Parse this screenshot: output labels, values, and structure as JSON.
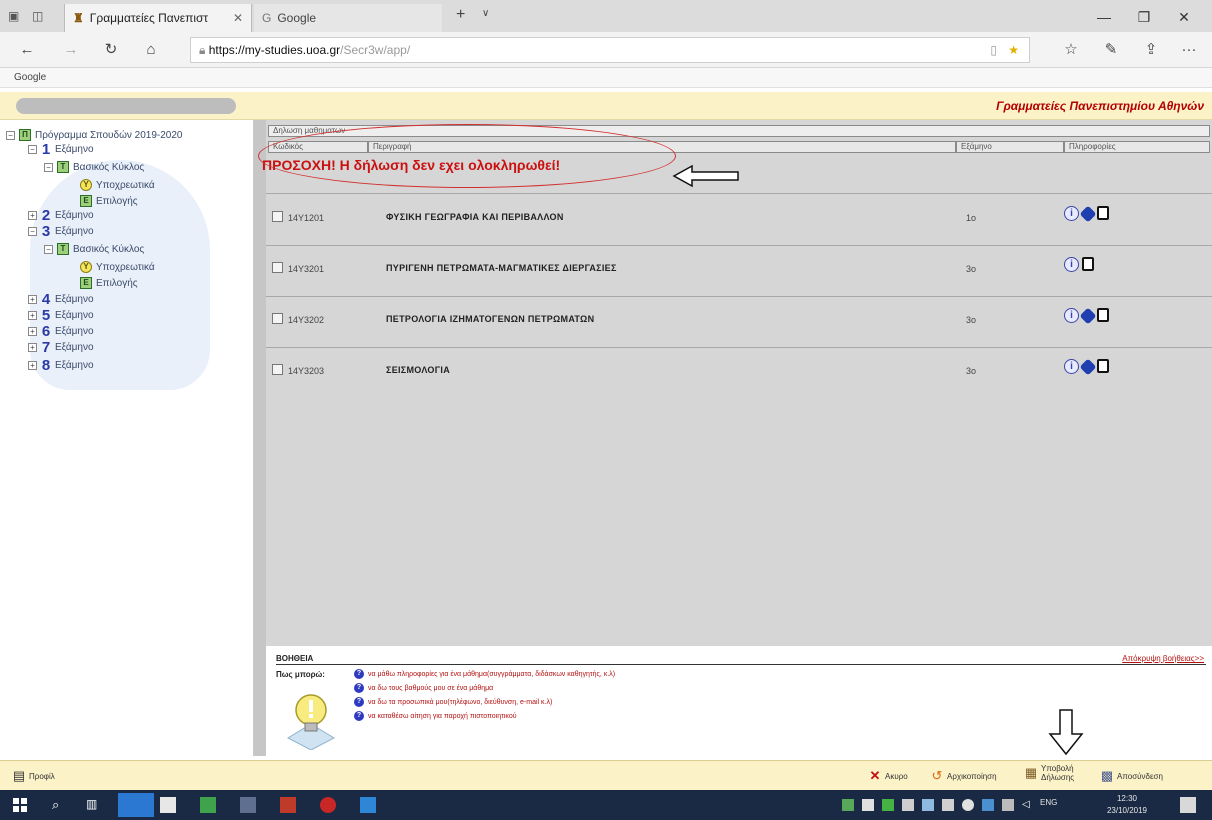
{
  "browser": {
    "tab_active": "Γραμματείες Πανεπιστ",
    "tab_inactive": "Google",
    "new_tab": "+",
    "url_host": "https://my-studies.uoa.gr",
    "url_path": "/Secr3w/app/",
    "favorites_item": "Google"
  },
  "app": {
    "brand": "Γραμματείες Πανεπιστημίου Αθηνών"
  },
  "tree": {
    "root_label": "Πρόγραμμα Σπουδών 2019-2020",
    "semester_label": "Εξάμηνο",
    "semesters": [
      "1",
      "2",
      "3",
      "4",
      "5",
      "6",
      "7",
      "8"
    ],
    "group_label": "Βασικός Κύκλος",
    "sub1": "Υποχρεωτικά",
    "sub2": "Επιλογής"
  },
  "main": {
    "title": "Δηλωση μαθηματων",
    "col_code": "Κωδικός",
    "col_desc": "Περιγραφή",
    "col_sem": "Εξάμηνο",
    "col_info": "Πληροφορίες",
    "warning": "ΠΡΟΣΟΧΗ! Η δήλωση δεν εχει ολοκληρωθεί!",
    "courses": [
      {
        "code": "14Υ1201",
        "desc": "ΦΥΣΙΚΗ ΓΕΩΓΡΑΦΙΑ ΚΑΙ ΠΕΡΙΒΑΛΛΟΝ",
        "sem": "1ο"
      },
      {
        "code": "14Υ3201",
        "desc": "ΠΥΡΙΓΕΝΗ ΠΕΤΡΩΜΑΤΑ-ΜΑΓΜΑΤΙΚΕΣ ΔΙΕΡΓΑΣΙΕΣ",
        "sem": "3ο"
      },
      {
        "code": "14Υ3202",
        "desc": "ΠΕΤΡΟΛΟΓΙΑ ΙΖΗΜΑΤΟΓΕΝΩΝ ΠΕΤΡΩΜΑΤΩΝ",
        "sem": "3ο"
      },
      {
        "code": "14Υ3203",
        "desc": "ΣΕΙΣΜΟΛΟΓΙΑ",
        "sem": "3ο"
      }
    ]
  },
  "help": {
    "title": "ΒΟΗΘΕΙΑ",
    "hide": "Απόκρυψη βοήθειας>>",
    "how": "Πως μπορώ:",
    "items": [
      "να μάθω πληροφορίες για ένα μάθημα(συγγράμματα, διδάσκων καθηγητής, κ.λ)",
      "να δω τους βαθμούς μου σε ένα μάθημα",
      "να δω τα προσωπικά μου(τηλέφωνο, διεύθυνση, e-mail κ.λ)",
      "να καταθέσω αίτηση για παροχή πιστοποιητικού"
    ]
  },
  "footer": {
    "profile": "Προφίλ",
    "cancel": "Ακυρο",
    "reset": "Αρχικοποίηση",
    "submit_line1": "Υποβολή",
    "submit_line2": "Δήλωσης",
    "print": "Αποσύνδεση"
  },
  "taskbar": {
    "lang": "ENG",
    "time": "12:30",
    "date": "23/10/2019"
  },
  "colors": {
    "warning": "#cc1010",
    "brand": "#b40000",
    "header_bg": "#fbf2c8",
    "taskbar_bg": "#1a2a44"
  }
}
